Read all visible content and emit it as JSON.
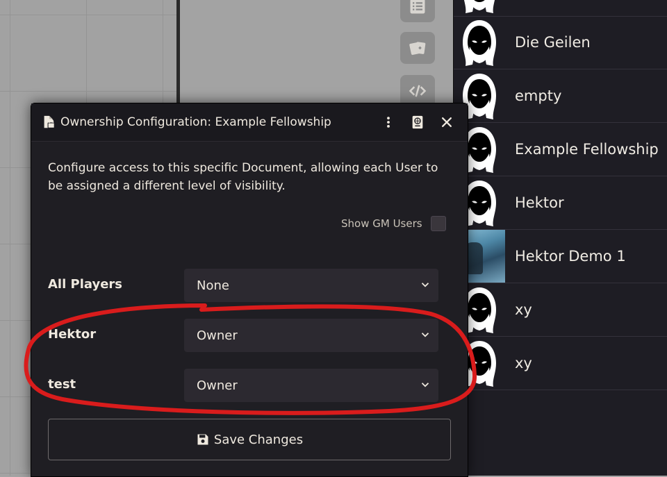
{
  "dialog": {
    "title": "Ownership Configuration: Example Fellowship",
    "intro": "Configure access to this specific Document, allowing each User to be assigned a different level of visibility.",
    "show_gm_label": "Show GM Users",
    "show_gm_checked": false,
    "permissions": [
      {
        "label": "All Players",
        "value": "None"
      },
      {
        "label": "Hektor",
        "value": "Owner"
      },
      {
        "label": "test",
        "value": "Owner"
      }
    ],
    "save_label": "Save Changes"
  },
  "sidebar": {
    "actors": [
      {
        "name": "",
        "thumb": "hooded-figure-icon"
      },
      {
        "name": "Die Geilen",
        "thumb": "hooded-figure-icon"
      },
      {
        "name": "empty",
        "thumb": "hooded-figure-icon"
      },
      {
        "name": "Example Fellowship",
        "thumb": "hooded-figure-icon"
      },
      {
        "name": "Hektor",
        "thumb": "hooded-figure-icon"
      },
      {
        "name": "Hektor Demo 1",
        "thumb": "portrait-image"
      },
      {
        "name": "xy",
        "thumb": "hooded-figure-icon"
      },
      {
        "name": "xy",
        "thumb": "hooded-figure-icon"
      }
    ]
  },
  "toolbar": {
    "icons": [
      "list-icon",
      "cards-icon",
      "code-icon"
    ]
  },
  "colors": {
    "dialog_bg": "#1f1e23",
    "sidebar_bg": "#1e1d24",
    "annotation_red": "#d91c1c",
    "text": "#efe9df"
  }
}
